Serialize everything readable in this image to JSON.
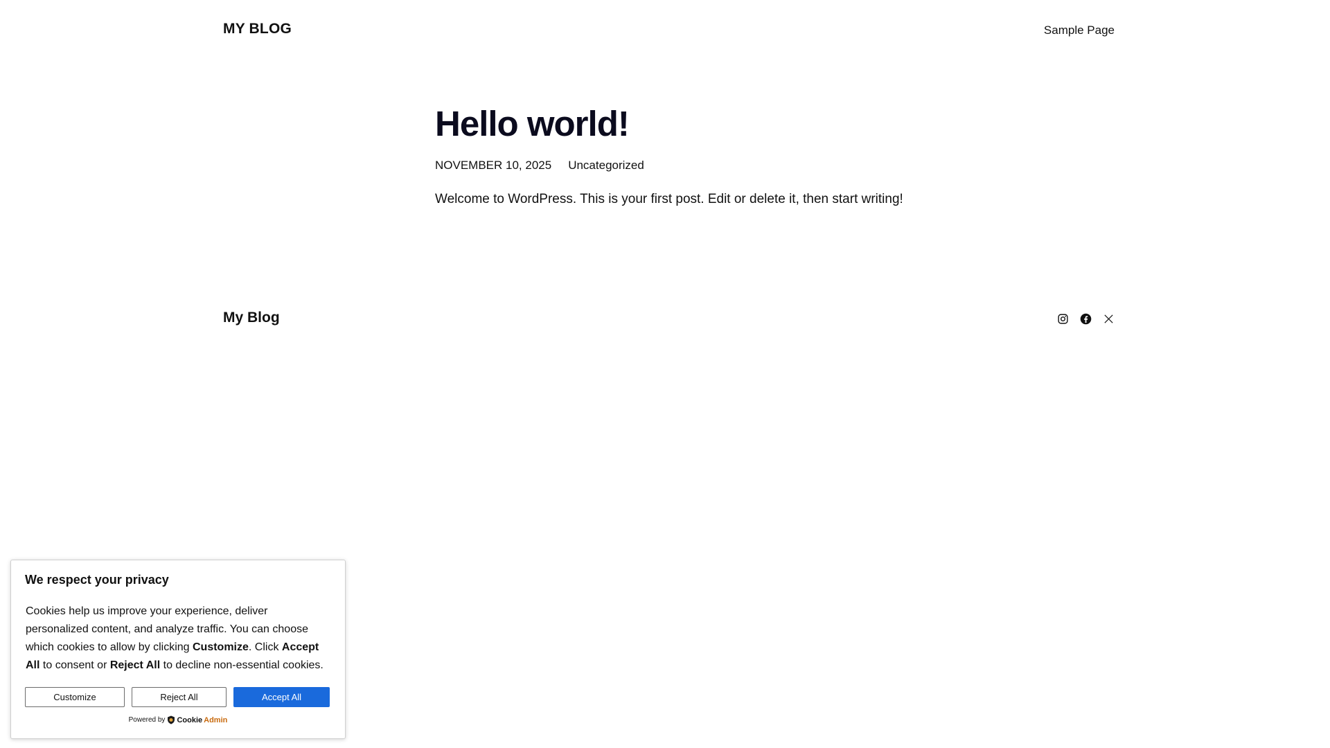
{
  "header": {
    "site_title": "MY BLOG",
    "nav": [
      {
        "label": "Sample Page"
      }
    ]
  },
  "post": {
    "title": "Hello world!",
    "date": "NOVEMBER 10, 2025",
    "category": "Uncategorized",
    "body": "Welcome to WordPress. This is your first post. Edit or delete it, then start writing!"
  },
  "footer": {
    "site_title": "My Blog",
    "social": [
      {
        "icon": "instagram-icon"
      },
      {
        "icon": "facebook-icon"
      },
      {
        "icon": "x-icon"
      }
    ]
  },
  "cookie": {
    "title": "We respect your privacy",
    "text_1": "Cookies help us improve your experience, deliver personalized content, and analyze traffic. You can choose which cookies to allow by clicking ",
    "bold_1": "Customize",
    "text_2": ". Click ",
    "bold_2": "Accept All",
    "text_3": " to consent or ",
    "bold_3": "Reject All",
    "text_4": " to decline non-essential cookies.",
    "customize_label": "Customize",
    "reject_label": "Reject All",
    "accept_label": "Accept All",
    "powered_by": "Powered by",
    "brand_part1": "Cookie",
    "brand_part2": "Admin",
    "accept_color": "#1a6adc",
    "brand_accent_color": "#c86a0e"
  }
}
